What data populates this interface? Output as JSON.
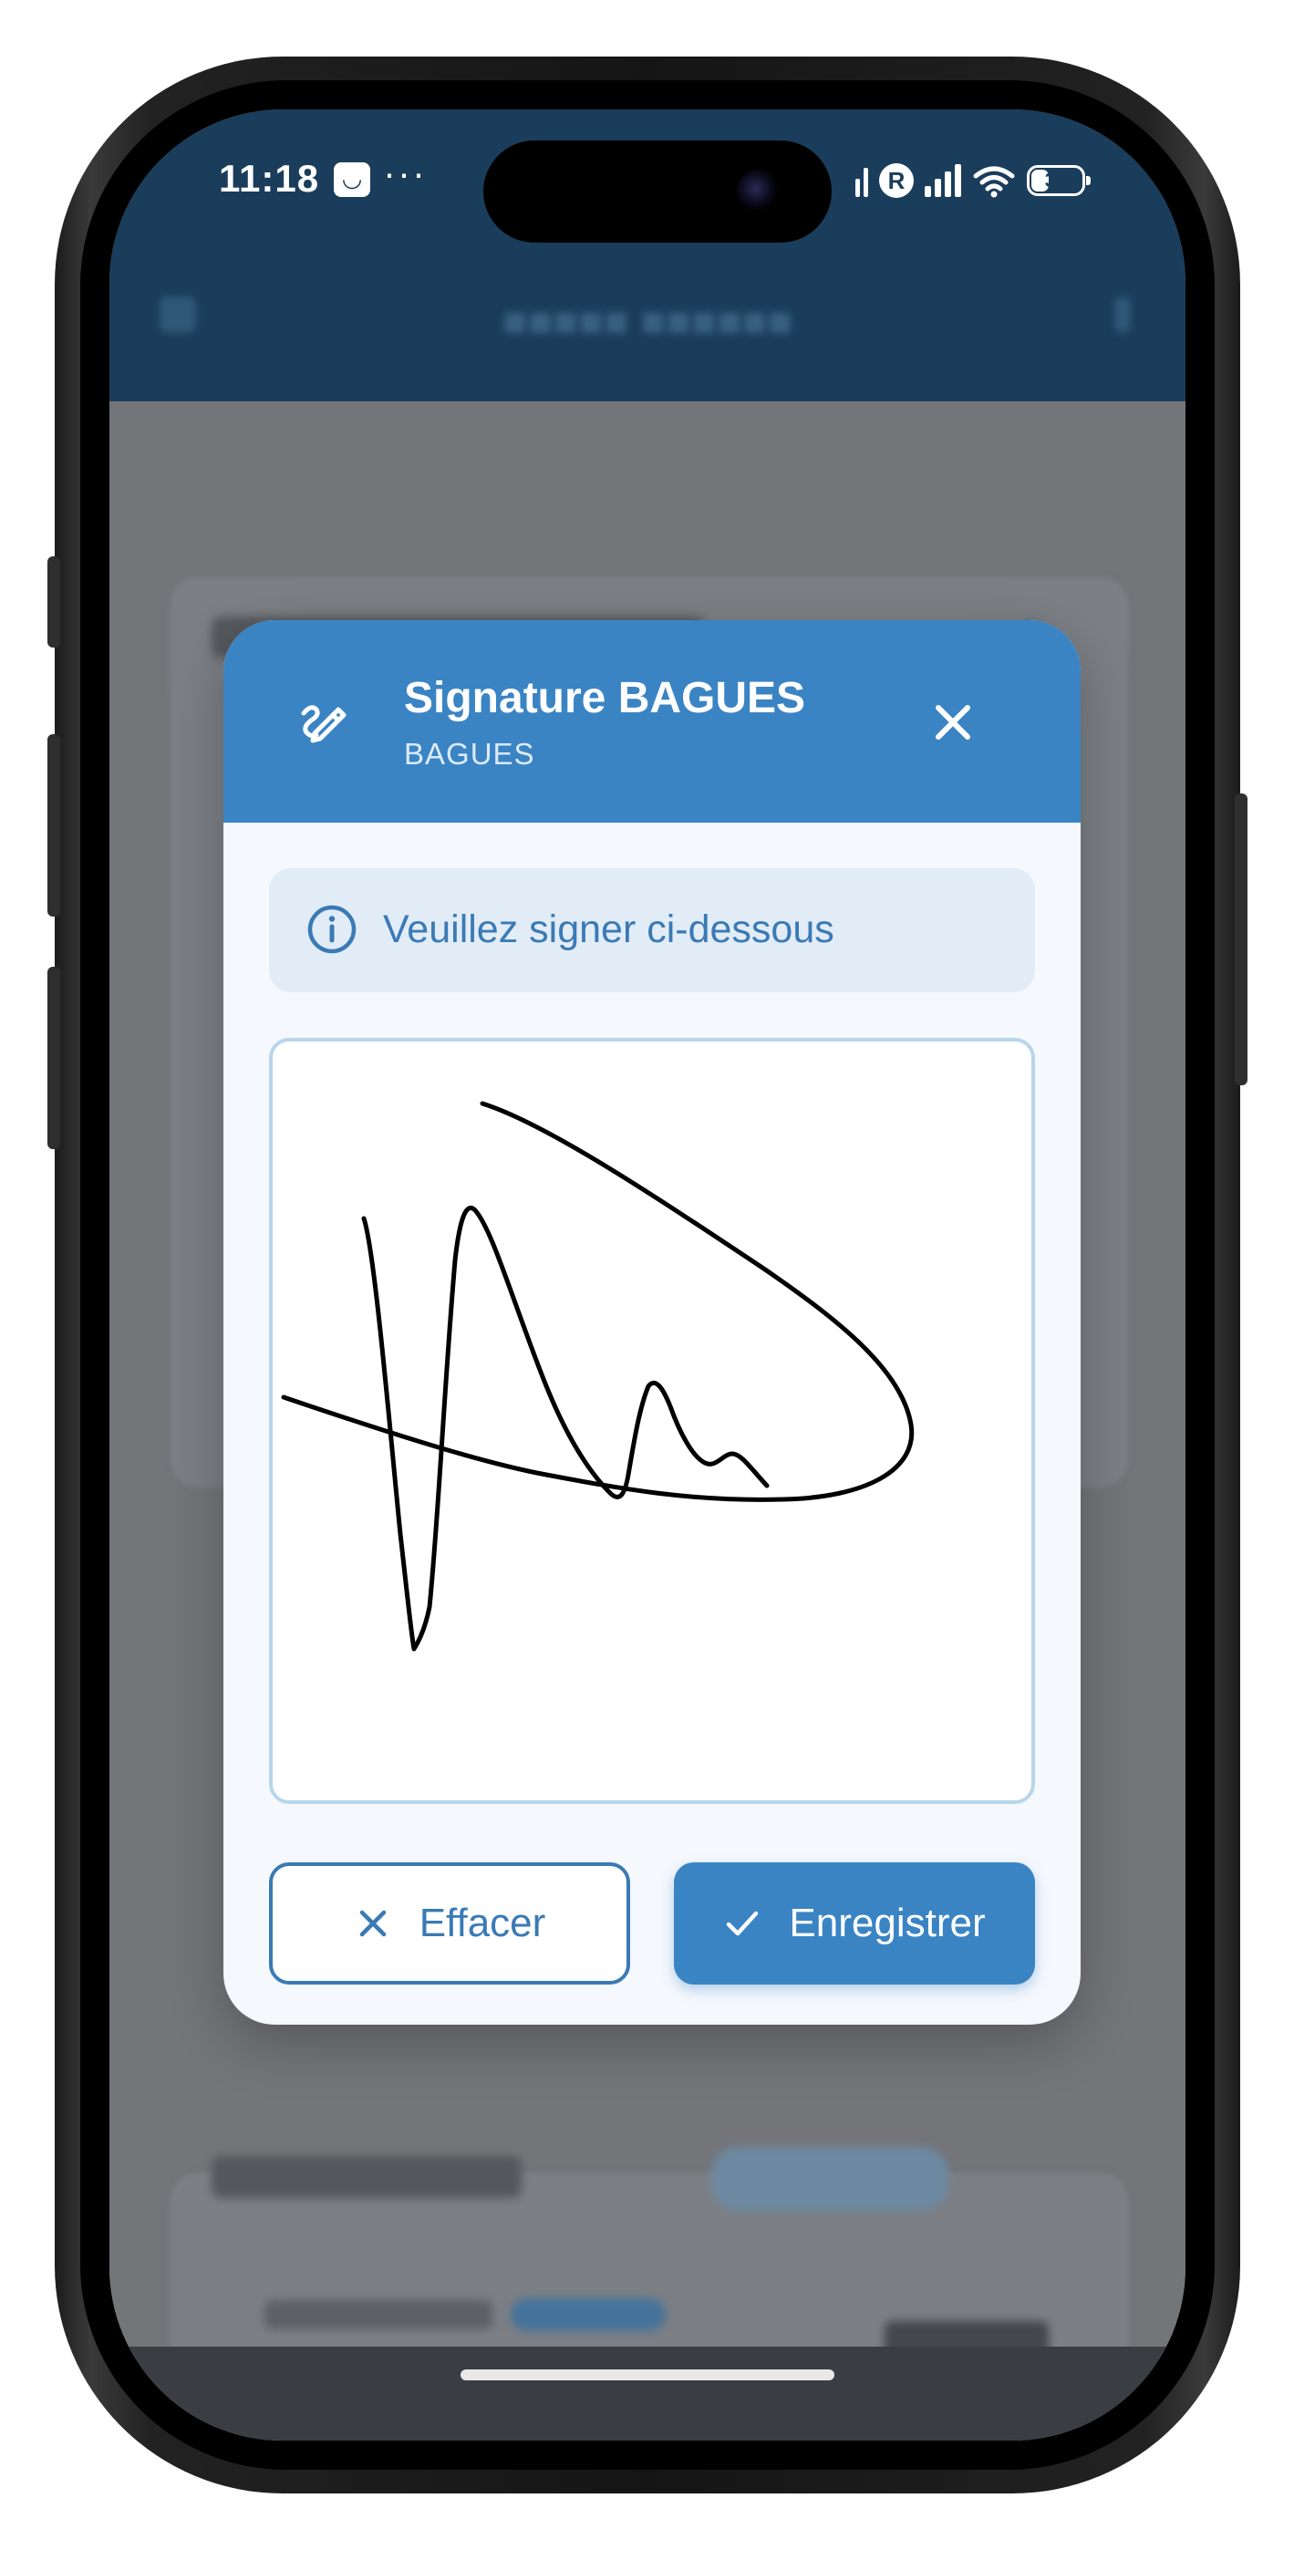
{
  "status_bar": {
    "time": "11:18",
    "more": "···",
    "roaming_letter": "R",
    "battery_percent": "37",
    "battery_level": 0.37,
    "icons": [
      "notification-app-icon",
      "signal-icon",
      "roaming-icon",
      "signal-icon",
      "wifi-icon",
      "battery-icon"
    ]
  },
  "modal": {
    "header_icon": "signature-pen-icon",
    "title": "Signature BAGUES",
    "subtitle": "BAGUES",
    "close_icon": "close-icon",
    "info": {
      "icon": "info-icon",
      "text": "Veuillez signer ci-dessous"
    },
    "signature_pad": {
      "stroke_color": "#000000",
      "has_signature": true
    },
    "buttons": {
      "clear_label": "Effacer",
      "clear_icon": "close-icon",
      "save_label": "Enregistrer",
      "save_icon": "check-icon"
    }
  },
  "colors": {
    "app_header": "#1a3d5b",
    "modal_header": "#3a84c4",
    "accent": "#3a7ab5",
    "info_background": "#e2ecf7",
    "pad_border": "#b7d6ec",
    "overlay": "#737579"
  }
}
